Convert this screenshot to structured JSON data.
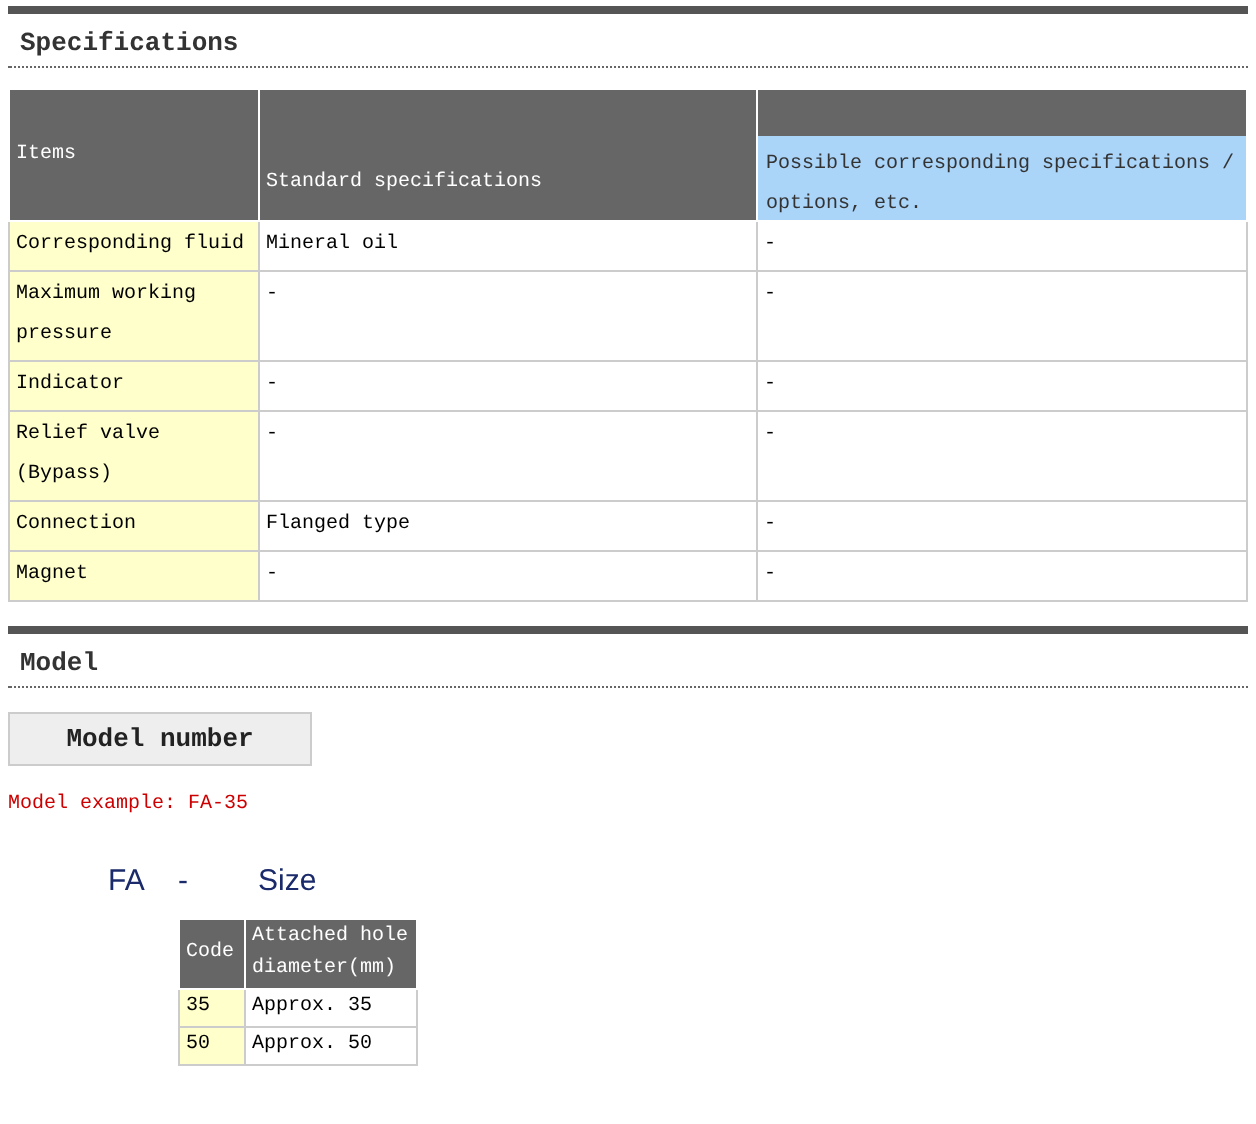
{
  "sections": [
    {
      "title": "Specifications",
      "kind": "spec_table",
      "table": {
        "columns": [
          {
            "label": "Items",
            "highlighted": false
          },
          {
            "label": "Standard specifications",
            "highlighted": false
          },
          {
            "label": "Possible corresponding specifications / options, etc.",
            "highlighted": true
          }
        ],
        "rows": [
          [
            "Corresponding fluid",
            "Mineral oil",
            "-"
          ],
          [
            "Maximum working pressure",
            "-",
            "-"
          ],
          [
            "Indicator",
            "-",
            "-"
          ],
          [
            "Relief valve (Bypass)",
            "-",
            "-"
          ],
          [
            "Connection",
            "Flanged type",
            "-"
          ],
          [
            "Magnet",
            "-",
            "-"
          ]
        ]
      }
    },
    {
      "title": "Model",
      "kind": "model",
      "tab": "Model number",
      "example": "Model example: FA-35",
      "code_parts": [
        "FA",
        "-",
        "Size"
      ],
      "table": {
        "columns": [
          {
            "label": "Code",
            "highlighted": false
          },
          {
            "label": "Attached hole diameter(mm)",
            "highlighted": false
          }
        ],
        "rows": [
          [
            "35",
            "Approx. 35"
          ],
          [
            "50",
            "Approx. 50"
          ]
        ]
      }
    }
  ]
}
